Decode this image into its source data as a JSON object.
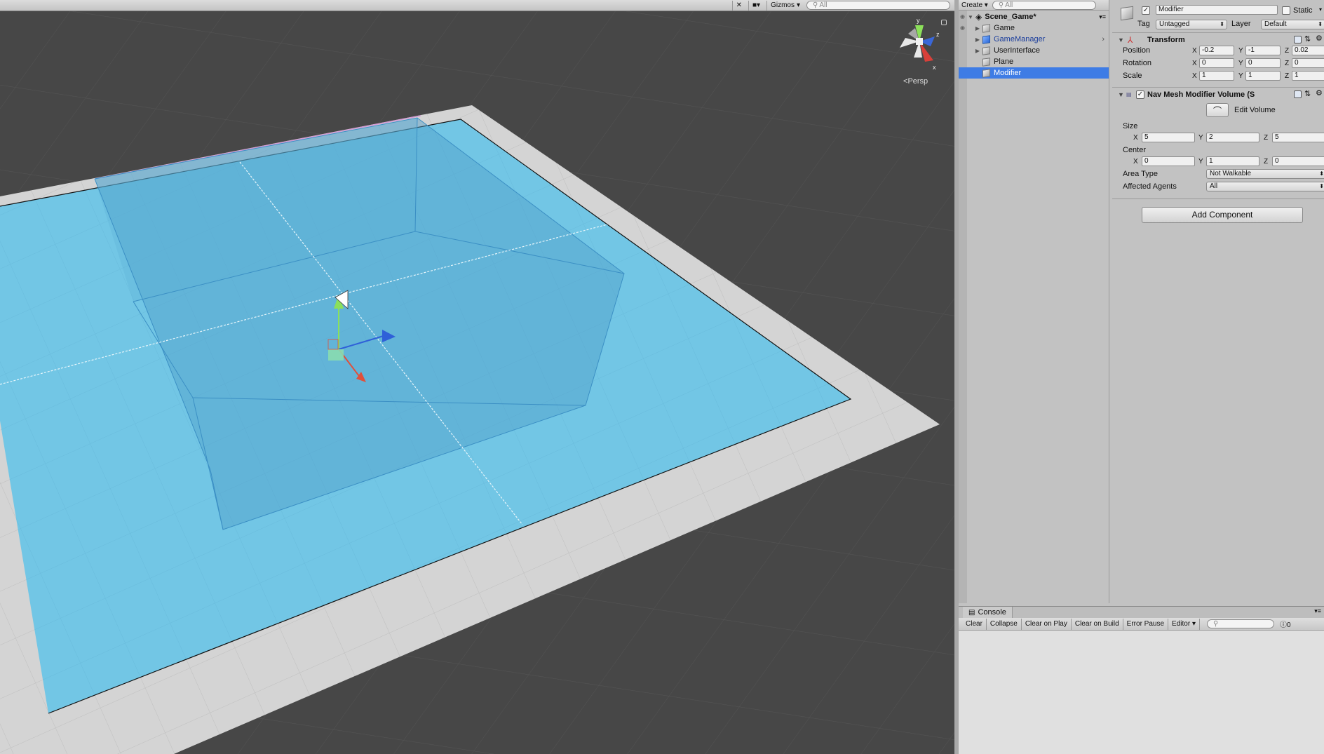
{
  "scene_view": {
    "toolbar": {
      "gizmos_label": "Gizmos",
      "search_placeholder": "All"
    },
    "gizmo_axes": {
      "x": "x",
      "y": "y",
      "z": "z"
    },
    "projection_label": "Persp",
    "colors": {
      "background": "#474747",
      "plane": "#d4d4d4",
      "navmesh": "#6fc4e4",
      "volume": "#5aa9d4"
    }
  },
  "hierarchy": {
    "create_label": "Create",
    "search_placeholder": "All",
    "scene_name": "Scene_Game*",
    "items": [
      {
        "label": "Game",
        "expandable": true
      },
      {
        "label": "GameManager",
        "expandable": true
      },
      {
        "label": "UserInterface",
        "expandable": true
      },
      {
        "label": "Plane",
        "expandable": false
      },
      {
        "label": "Modifier",
        "expandable": false,
        "selected": true
      }
    ]
  },
  "inspector": {
    "object_name": "Modifier",
    "static_label": "Static",
    "tag_label": "Tag",
    "tag_value": "Untagged",
    "layer_label": "Layer",
    "layer_value": "Default",
    "transform": {
      "title": "Transform",
      "position_label": "Position",
      "rotation_label": "Rotation",
      "scale_label": "Scale",
      "position": {
        "x": "-0.2",
        "y": "-1",
        "z": "0.02"
      },
      "rotation": {
        "x": "0",
        "y": "0",
        "z": "0"
      },
      "scale": {
        "x": "1",
        "y": "1",
        "z": "1"
      }
    },
    "navmesh": {
      "title": "Nav Mesh Modifier Volume (S",
      "edit_volume_label": "Edit Volume",
      "size_label": "Size",
      "size": {
        "x": "5",
        "y": "2",
        "z": "5"
      },
      "center_label": "Center",
      "center": {
        "x": "0",
        "y": "1",
        "z": "0"
      },
      "area_type_label": "Area Type",
      "area_type_value": "Not Walkable",
      "affected_agents_label": "Affected Agents",
      "affected_agents_value": "All"
    },
    "add_component_label": "Add Component",
    "axis_labels": {
      "x": "X",
      "y": "Y",
      "z": "Z"
    }
  },
  "console": {
    "tab_label": "Console",
    "buttons": [
      "Clear",
      "Collapse",
      "Clear on Play",
      "Clear on Build",
      "Error Pause",
      "Editor"
    ],
    "error_count": "0"
  }
}
